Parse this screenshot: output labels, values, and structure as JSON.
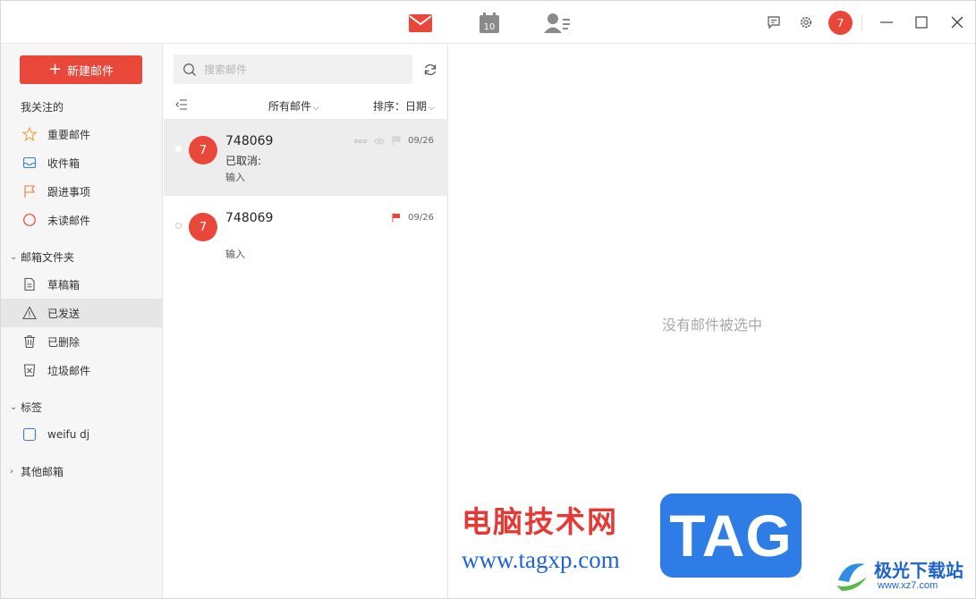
{
  "colors": {
    "accent": "#e8473a",
    "sidebar_bg": "#f6f6f6",
    "selected_row_bg": "#ededed",
    "brand_blue": "#2e7de6"
  },
  "topbar": {
    "tabs": [
      {
        "name": "mail",
        "icon": "mail-icon",
        "active": true
      },
      {
        "name": "calendar",
        "icon": "calendar-icon",
        "day": "10"
      },
      {
        "name": "contacts",
        "icon": "contacts-icon"
      }
    ],
    "user_avatar_text": "7"
  },
  "sidebar": {
    "compose_label": "新建邮件",
    "favorites_title": "我关注的",
    "favorites": [
      {
        "label": "重要邮件",
        "icon": "star-icon"
      },
      {
        "label": "收件箱",
        "icon": "inbox-icon"
      },
      {
        "label": "跟进事项",
        "icon": "flag-icon"
      },
      {
        "label": "未读邮件",
        "icon": "unread-circle-icon"
      }
    ],
    "folders_title": "邮箱文件夹",
    "folders": [
      {
        "label": "草稿箱",
        "icon": "draft-icon"
      },
      {
        "label": "已发送",
        "icon": "sent-icon",
        "active": true
      },
      {
        "label": "已删除",
        "icon": "trash-icon"
      },
      {
        "label": "垃圾邮件",
        "icon": "spam-icon"
      }
    ],
    "tags_title": "标签",
    "tags": [
      {
        "label": "weifu dj",
        "icon": "tag-checkbox-icon"
      }
    ],
    "other_title": "其他邮箱"
  },
  "list": {
    "search_placeholder": "搜索邮件",
    "filter_label": "所有邮件",
    "sort_label": "排序：日期",
    "items": [
      {
        "avatar": "7",
        "sender": "748069",
        "subject": "已取消:",
        "preview": "输入",
        "date": "09/26",
        "selected": true,
        "flagged": false
      },
      {
        "avatar": "7",
        "sender": "748069",
        "subject": "",
        "preview": "输入",
        "date": "09/26",
        "selected": false,
        "flagged": true
      }
    ]
  },
  "reader": {
    "empty_text": "没有邮件被选中"
  },
  "watermark": {
    "site_cn": "电脑技术网",
    "site_url": "www.tagxp.com",
    "tag": "TAG",
    "site2_cn": "极光下载站",
    "site2_url": "www.xz7.com"
  }
}
